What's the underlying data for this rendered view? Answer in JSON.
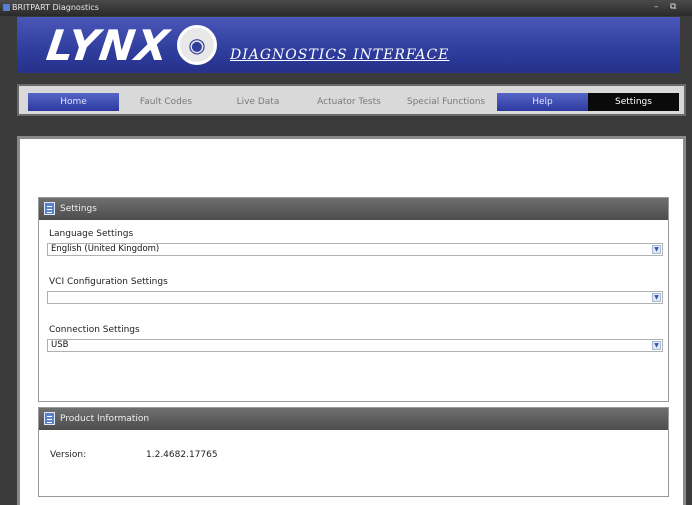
{
  "window": {
    "title": "BRITPART Diagnostics",
    "minimize": "–",
    "restore": "⧉",
    "close": "✕"
  },
  "banner": {
    "logo": "LYNX",
    "subtitle": "DIAGNOSTICS INTERFACE"
  },
  "nav": {
    "tabs": [
      {
        "label": "Home"
      },
      {
        "label": "Fault Codes"
      },
      {
        "label": "Live Data"
      },
      {
        "label": "Actuator Tests"
      },
      {
        "label": "Special Functions"
      },
      {
        "label": "Help"
      },
      {
        "label": "Settings"
      }
    ]
  },
  "settings": {
    "title": "Settings",
    "language": {
      "label": "Language Settings",
      "value": "English (United Kingdom)"
    },
    "vci": {
      "label": "VCI Configuration Settings",
      "value": ""
    },
    "connection": {
      "label": "Connection Settings",
      "value": "USB"
    }
  },
  "product": {
    "title": "Product Information",
    "version_label": "Version:",
    "version_value": "1.2.4682.17765"
  },
  "colors": {
    "banner": "#2f3d9d",
    "accent_tab": "#3a48ad",
    "active_tab": "#0a0a0a",
    "panel_header": "#5e5e5e"
  }
}
